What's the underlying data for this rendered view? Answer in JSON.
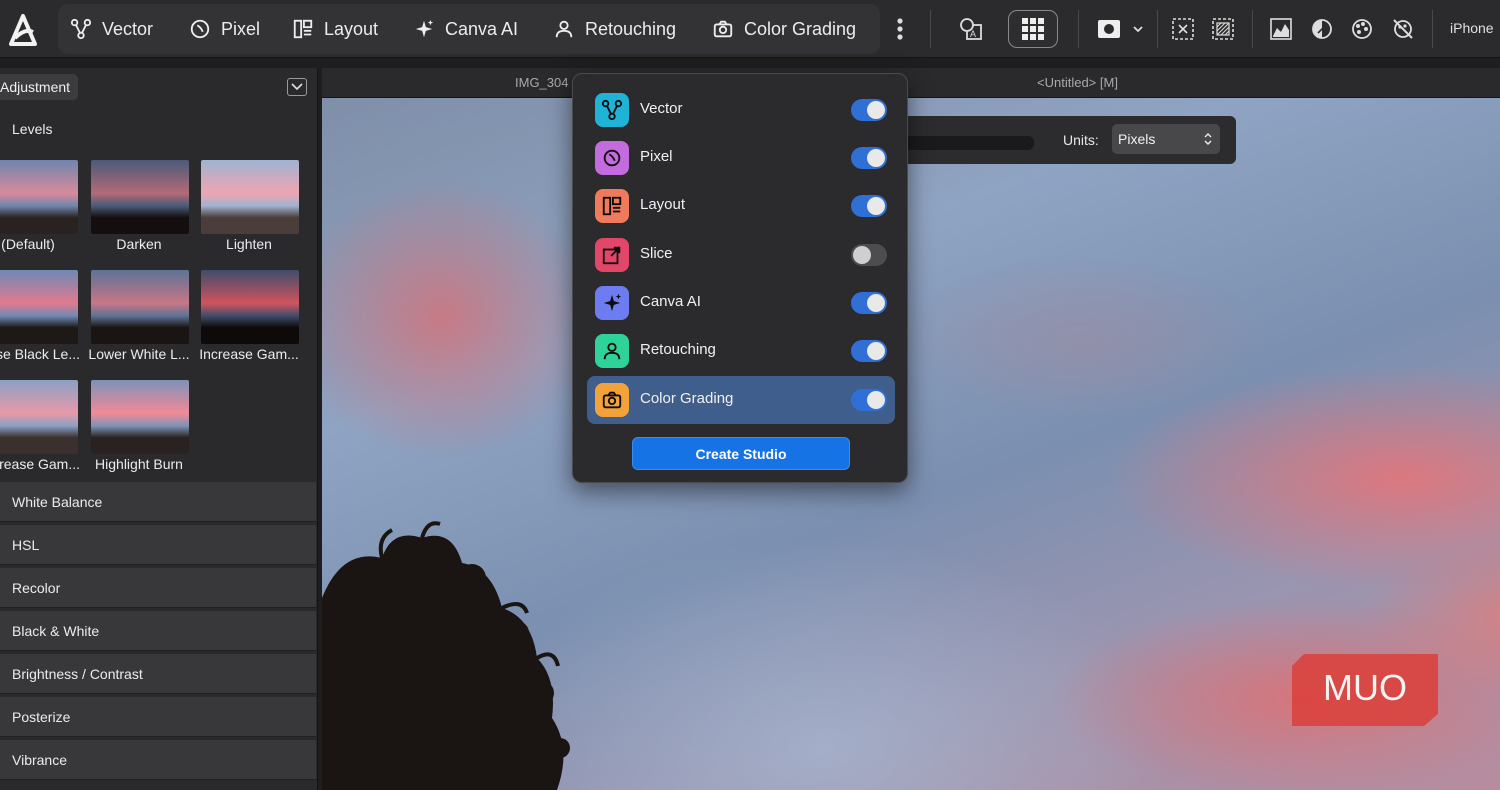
{
  "toolbar": {
    "personas": [
      {
        "label": "Vector",
        "icon": "vector-persona-icon"
      },
      {
        "label": "Pixel",
        "icon": "pixel-persona-icon"
      },
      {
        "label": "Layout",
        "icon": "layout-persona-icon"
      },
      {
        "label": "Canva AI",
        "icon": "canva-ai-sparkle-icon"
      },
      {
        "label": "Retouching",
        "icon": "retouching-person-icon"
      },
      {
        "label": "Color Grading",
        "icon": "camera-icon"
      }
    ],
    "device_label": "iPhone"
  },
  "panel": {
    "tab_label": "Adjustment",
    "levels_header": "Levels",
    "presets": [
      {
        "label": "(Default)"
      },
      {
        "label": "Darken"
      },
      {
        "label": "Lighten"
      },
      {
        "label": "se Black Le..."
      },
      {
        "label": "Lower White L..."
      },
      {
        "label": "Increase Gam..."
      },
      {
        "label": "rease Gam..."
      },
      {
        "label": "Highlight Burn"
      }
    ],
    "sections": [
      "White Balance",
      "HSL",
      "Recolor",
      "Black & White",
      "Brightness / Contrast",
      "Posterize",
      "Vibrance"
    ]
  },
  "documents": {
    "tab1": "IMG_304",
    "tab2": "<Untitled> [M]"
  },
  "units": {
    "label": "Units:",
    "value": "Pixels"
  },
  "popover": {
    "items": [
      {
        "label": "Vector",
        "enabled": true,
        "color": "#1fb3d6"
      },
      {
        "label": "Pixel",
        "enabled": true,
        "color": "#c46be0"
      },
      {
        "label": "Layout",
        "enabled": true,
        "color": "#f07a5c"
      },
      {
        "label": "Slice",
        "enabled": false,
        "color": "#e2476a"
      },
      {
        "label": "Canva AI",
        "enabled": true,
        "color": "#6d7cf0"
      },
      {
        "label": "Retouching",
        "enabled": true,
        "color": "#2fd39a"
      },
      {
        "label": "Color Grading",
        "enabled": true,
        "color": "#f3a23a",
        "selected": true
      }
    ],
    "create_button": "Create Studio"
  },
  "watermark": "MUO"
}
